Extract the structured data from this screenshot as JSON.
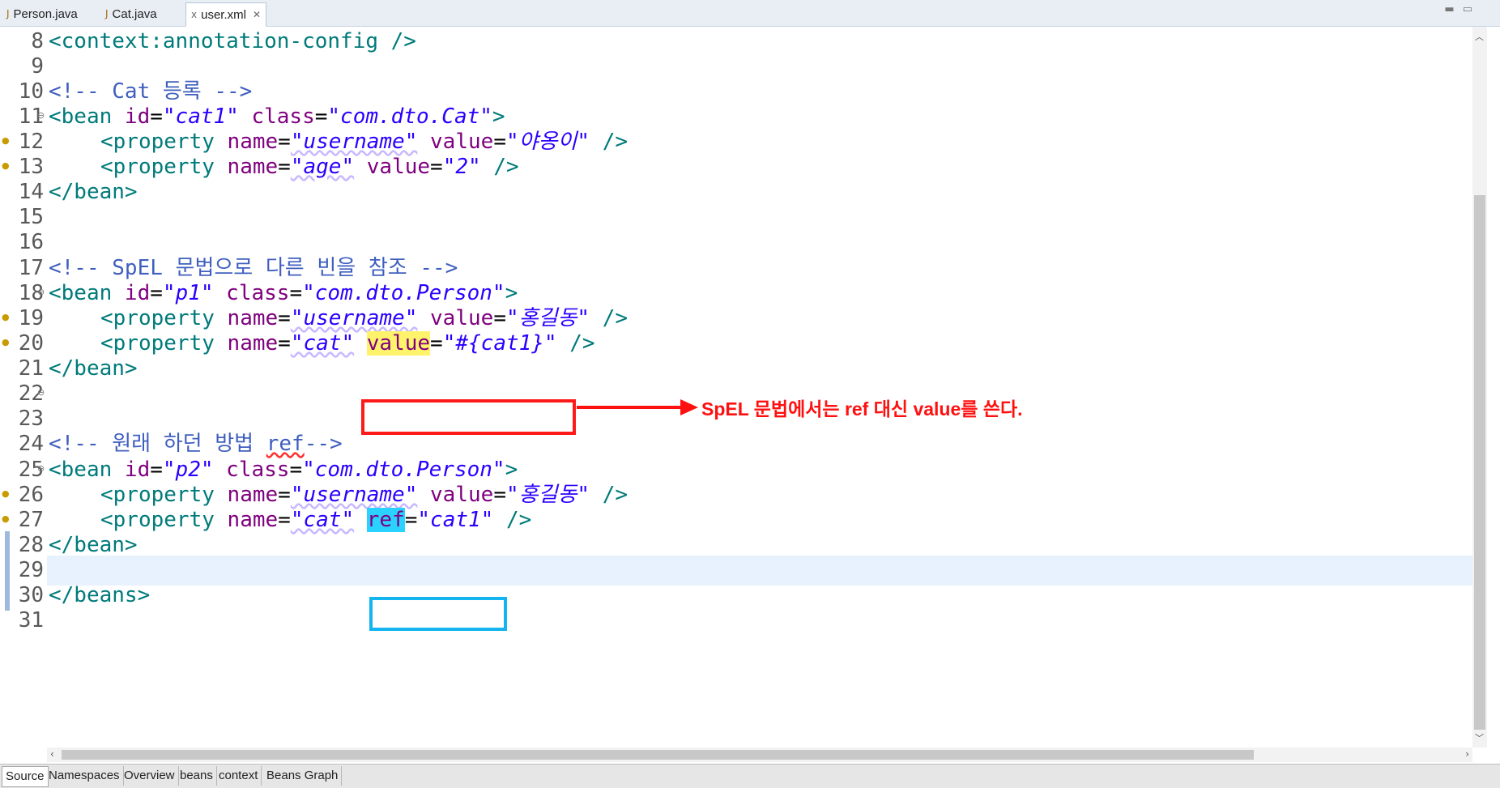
{
  "tabs": [
    {
      "label": "Person.java",
      "icon": "java-file-icon",
      "active": false
    },
    {
      "label": "Cat.java",
      "icon": "java-file-icon",
      "active": false
    },
    {
      "label": "user.xml",
      "icon": "xml-file-icon",
      "active": true
    }
  ],
  "editor": {
    "lines": [
      {
        "n": "8"
      },
      {
        "n": "9"
      },
      {
        "n": "10"
      },
      {
        "n": "11"
      },
      {
        "n": "12"
      },
      {
        "n": "13"
      },
      {
        "n": "14"
      },
      {
        "n": "15"
      },
      {
        "n": "16"
      },
      {
        "n": "17"
      },
      {
        "n": "18"
      },
      {
        "n": "19"
      },
      {
        "n": "20"
      },
      {
        "n": "21"
      },
      {
        "n": "22"
      },
      {
        "n": "23"
      },
      {
        "n": "24"
      },
      {
        "n": "25"
      },
      {
        "n": "26"
      },
      {
        "n": "27"
      },
      {
        "n": "28"
      },
      {
        "n": "29"
      },
      {
        "n": "30"
      },
      {
        "n": "31"
      }
    ],
    "code": {
      "l8": "<context:annotation-config />",
      "l10_comment": "<!-- Cat 등록 -->",
      "l11_open": "<bean ",
      "l11_id_attr": "id",
      "l11_id_val": "\"cat1\"",
      "l11_class_attr": "class",
      "l11_class_val": "\"com.dto.Cat\"",
      "l12_name_val": "\"username\"",
      "l12_value_val": "\"야옹이\"",
      "l13_name_val": "\"age\"",
      "l13_value_val": "\"2\"",
      "bean_close": "</bean>",
      "l17_comment": "<!-- SpEL 문법으로 다른 빈을 참조 -->",
      "l18_id_val": "\"p1\"",
      "l18_class_val": "\"com.dto.Person\"",
      "l19_name_val": "\"username\"",
      "l19_value_val": "\"홍길동\"",
      "l20_name_val": "\"cat\"",
      "l20_value_attr": "value",
      "l20_value_val": "\"#{cat1}\"",
      "l24_comment_pre": "<!-- 원래 하던 방법 ",
      "l24_comment_ref": "ref",
      "l24_comment_post": "-->",
      "l25_id_val": "\"p2\"",
      "l25_class_val": "\"com.dto.Person\"",
      "l26_name_val": "\"username\"",
      "l26_value_val": "\"홍길동\"",
      "l27_name_val": "\"cat\"",
      "l27_ref_attr": "ref",
      "l27_ref_val": "\"cat1\"",
      "l30": "</beans>",
      "property_open": "<property ",
      "name_attr": "name",
      "value_attr": "value",
      "self_close": " />"
    }
  },
  "annotation": {
    "note": "SpEL 문법에서는 ref 대신 value를 쓴다.",
    "arrow_color": "#ff1010",
    "red_box_color": "#ff1a1a",
    "blue_box_color": "#14b4f0"
  },
  "bottom_tabs": [
    "Source",
    "Namespaces",
    "Overview",
    "beans",
    "context",
    "Beans Graph"
  ],
  "colors": {
    "comment": "#3f5fbf",
    "tag": "#007a7a",
    "attribute": "#7f007f",
    "value": "#2a00ff",
    "current_line": "#e8f2fe"
  }
}
